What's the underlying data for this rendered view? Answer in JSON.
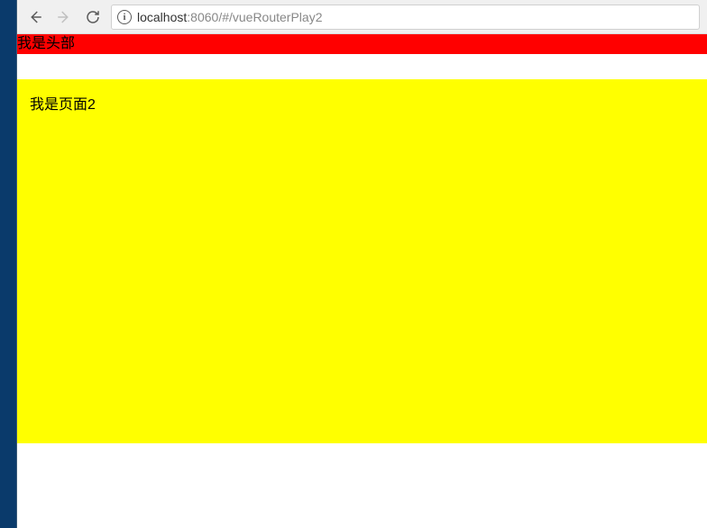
{
  "browser": {
    "url_host": "localhost",
    "url_port": ":8060",
    "url_path": "/#/vueRouterPlay2"
  },
  "page": {
    "header_text": "我是头部",
    "content_text": "我是页面2"
  },
  "colors": {
    "header_bg": "#ff0000",
    "content_bg": "#ffff00"
  }
}
